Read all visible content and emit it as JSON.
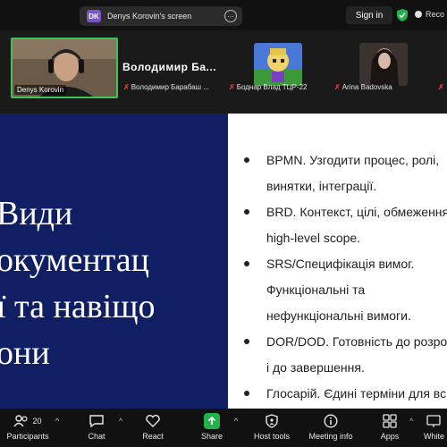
{
  "topbar": {
    "share_badge": "DK",
    "share_text": "Denys Korovin's screen",
    "more_glyph": "…",
    "signin": "Sign in",
    "record": "Reco"
  },
  "participants": {
    "self": {
      "name": "Denys Korovin"
    },
    "big_name": "Володимир  Ба...",
    "others": [
      {
        "name": "Володимир Барабаш ..."
      },
      {
        "name": "Боднар Влад ТЦР-22"
      },
      {
        "name": "Arina Badovska"
      }
    ]
  },
  "slide": {
    "title_lines": [
      "Види",
      "окументац",
      "ї та навіщо",
      "они"
    ],
    "bullets": [
      [
        "BPMN. Узгодити процес, ролі,",
        "винятки, інтеграції."
      ],
      [
        "BRD. Контекст, цілі, обмеження,",
        "high-level scope."
      ],
      [
        "SRS/Специфікація вимог.",
        "Функціональні та",
        "нефункціональні вимоги."
      ],
      [
        "DOR/DOD. Готовність до розро",
        "і до завершення."
      ],
      [
        "Глосарій. Єдині терміни для вс"
      ]
    ]
  },
  "toolbar": {
    "participants_label": "Participants",
    "participants_count": "20",
    "chat_label": "Chat",
    "react_label": "React",
    "share_label": "Share",
    "hosttools_label": "Host tools",
    "meetinginfo_label": "Meeting info",
    "apps_label": "Apps",
    "whiteboards_label": "White"
  },
  "colors": {
    "accent_green": "#3dc45a",
    "share_green": "#22b24c",
    "mute_red": "#e0393e",
    "slide_navy": "#101f63",
    "badge_purple": "#7a54c7"
  },
  "icons": [
    "shield-check-icon",
    "record-icon",
    "more-icon",
    "muted-mic-icon",
    "participants-icon",
    "chat-icon",
    "react-icon",
    "share-icon",
    "host-tools-icon",
    "info-icon",
    "apps-icon",
    "whiteboard-icon",
    "caret-up-icon"
  ]
}
